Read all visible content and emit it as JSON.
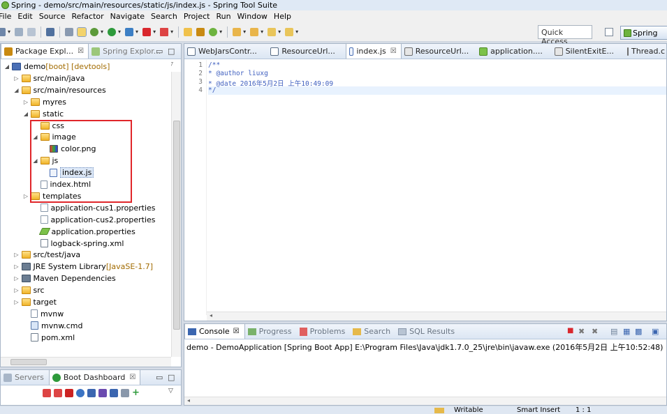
{
  "window": {
    "title": "Spring - demo/src/main/resources/static/js/index.js - Spring Tool Suite"
  },
  "menu": [
    "File",
    "Edit",
    "Source",
    "Refactor",
    "Navigate",
    "Search",
    "Project",
    "Run",
    "Window",
    "Help"
  ],
  "toolbar": {
    "quick_access": "Quick Access",
    "perspective": "Spring"
  },
  "package_explorer": {
    "tabs": [
      {
        "label": "Package Expl...",
        "close": "☒"
      },
      {
        "label": "Spring Explor...",
        "close": ""
      }
    ],
    "tree": [
      {
        "label": "demo",
        "deco": " [boot] [devtools]",
        "icon": "proj",
        "indent": 1,
        "twisty": "open"
      },
      {
        "label": "src/main/java",
        "deco": "",
        "icon": "pkgf",
        "indent": 2,
        "twisty": "closed"
      },
      {
        "label": "src/main/resources",
        "deco": "",
        "icon": "pkgf",
        "indent": 2,
        "twisty": "open"
      },
      {
        "label": "myres",
        "deco": "",
        "icon": "fold",
        "indent": 3,
        "twisty": "closed"
      },
      {
        "label": "static",
        "deco": "",
        "icon": "fold",
        "indent": 3,
        "twisty": "open"
      },
      {
        "label": "css",
        "deco": "",
        "icon": "fold",
        "indent": 4,
        "twisty": ""
      },
      {
        "label": "image",
        "deco": "",
        "icon": "fold",
        "indent": 4,
        "twisty": "open"
      },
      {
        "label": "color.png",
        "deco": "",
        "icon": "png",
        "indent": 5,
        "twisty": ""
      },
      {
        "label": "js",
        "deco": "",
        "icon": "fold",
        "indent": 4,
        "twisty": "open"
      },
      {
        "label": "index.js",
        "deco": "",
        "icon": "js",
        "indent": 5,
        "twisty": "",
        "selected": true
      },
      {
        "label": "index.html",
        "deco": "",
        "icon": "file",
        "indent": 4,
        "twisty": ""
      },
      {
        "label": "templates",
        "deco": "",
        "icon": "fold",
        "indent": 3,
        "twisty": "closed"
      },
      {
        "label": "application-cus1.properties",
        "deco": "",
        "icon": "prop",
        "indent": 4,
        "twisty": ""
      },
      {
        "label": "application-cus2.properties",
        "deco": "",
        "icon": "prop",
        "indent": 4,
        "twisty": ""
      },
      {
        "label": "application.properties",
        "deco": "",
        "icon": "app",
        "indent": 4,
        "twisty": ""
      },
      {
        "label": "logback-spring.xml",
        "deco": "",
        "icon": "xml",
        "indent": 4,
        "twisty": ""
      },
      {
        "label": "src/test/java",
        "deco": "",
        "icon": "pkgf",
        "indent": 2,
        "twisty": "closed"
      },
      {
        "label": "JRE System Library",
        "deco": " [JavaSE-1.7]",
        "icon": "jar",
        "indent": 2,
        "twisty": "closed"
      },
      {
        "label": "Maven Dependencies",
        "deco": "",
        "icon": "jar",
        "indent": 2,
        "twisty": "closed"
      },
      {
        "label": "src",
        "deco": "",
        "icon": "fold",
        "indent": 2,
        "twisty": "closed"
      },
      {
        "label": "target",
        "deco": "",
        "icon": "fold",
        "indent": 2,
        "twisty": "closed"
      },
      {
        "label": "mvnw",
        "deco": "",
        "icon": "file",
        "indent": 3,
        "twisty": ""
      },
      {
        "label": "mvnw.cmd",
        "deco": "",
        "icon": "cmd",
        "indent": 3,
        "twisty": ""
      },
      {
        "label": "pom.xml",
        "deco": "",
        "icon": "xml",
        "indent": 3,
        "twisty": ""
      }
    ]
  },
  "editor": {
    "tabs": [
      {
        "label": "WebJarsContr...",
        "active": false
      },
      {
        "label": "ResourceUrl...",
        "active": false
      },
      {
        "label": "index.js",
        "active": true
      },
      {
        "label": "ResourceUrl...",
        "active": false
      },
      {
        "label": "application....",
        "active": false
      },
      {
        "label": "SilentExitE...",
        "active": false
      },
      {
        "label": "Thread.c",
        "active": false
      }
    ],
    "lines": [
      {
        "n": "1",
        "text": "/**"
      },
      {
        "n": "2",
        "text": " * @author liuxg"
      },
      {
        "n": "3",
        "text": " * @date 2016年5月2日 上午10:49:09"
      },
      {
        "n": "4",
        "text": " */"
      }
    ]
  },
  "console": {
    "tabs": [
      {
        "label": "Console",
        "close": "☒",
        "active": true
      },
      {
        "label": "Progress",
        "active": false
      },
      {
        "label": "Problems",
        "active": false
      },
      {
        "label": "Search",
        "active": false
      },
      {
        "label": "SQL Results",
        "active": false
      }
    ],
    "text": "demo - DemoApplication [Spring Boot App] E:\\Program Files\\Java\\jdk1.7.0_25\\jre\\bin\\javaw.exe (2016年5月2日 上午10:52:48)"
  },
  "servers": {
    "tabs": [
      {
        "label": "Servers"
      },
      {
        "label": "Boot Dashboard",
        "close": "☒"
      }
    ]
  },
  "status": {
    "writable": "Writable",
    "insert": "Smart Insert",
    "position": "1 : 1"
  }
}
